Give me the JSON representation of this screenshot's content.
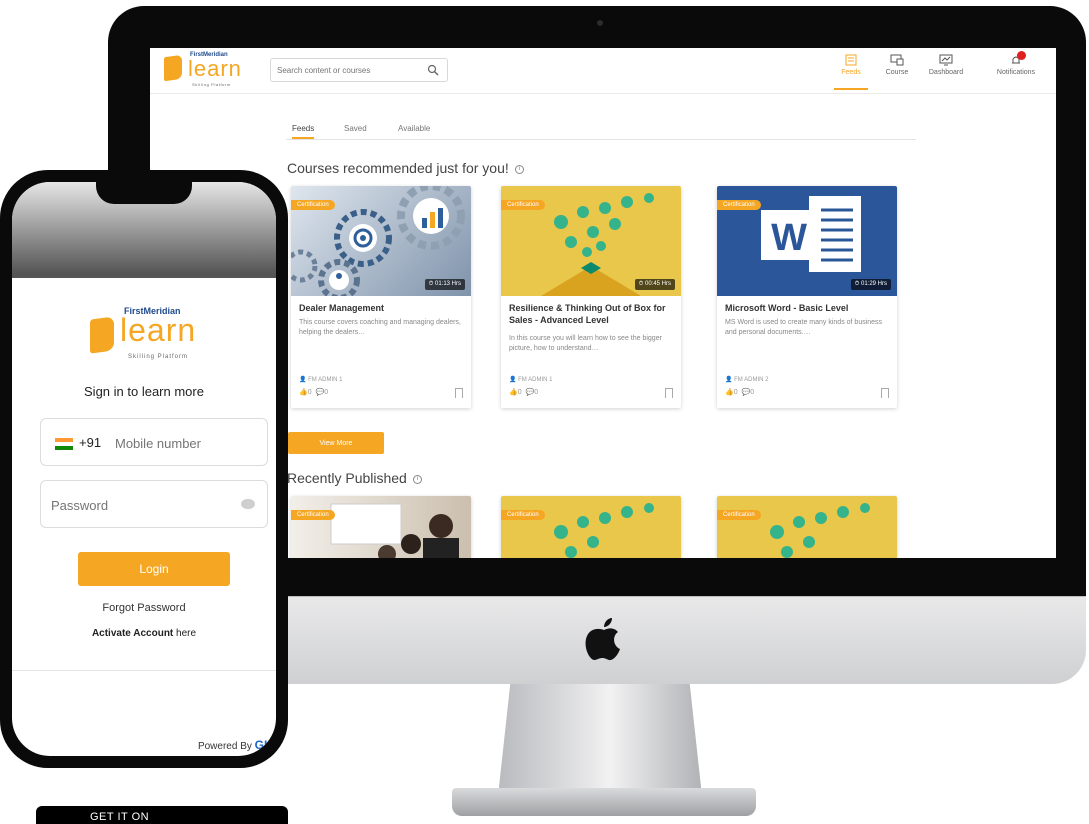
{
  "desktop": {
    "header": {
      "logo": {
        "brand_top": "FirstMeridian",
        "brand": "learn",
        "sub": "Skilling Platform"
      },
      "search_placeholder": "Search content or courses",
      "nav": [
        {
          "label": "Feeds",
          "icon": "feed-icon",
          "active": true
        },
        {
          "label": "Course",
          "icon": "course-icon",
          "active": false
        },
        {
          "label": "Dashboard",
          "icon": "dashboard-icon",
          "active": false
        },
        {
          "label": "Notifications",
          "icon": "bell-icon",
          "active": false
        }
      ]
    },
    "tabs": [
      {
        "label": "Feeds",
        "active": true
      },
      {
        "label": "Saved",
        "active": false
      },
      {
        "label": "Available",
        "active": false
      }
    ],
    "recommended": {
      "title": "Courses recommended just for you!",
      "cards": [
        {
          "badge": "Certification",
          "duration": "01:13 Hrs",
          "title": "Dealer Management",
          "desc": "This course covers coaching and managing dealers, helping the dealers…",
          "author": "FM ADMIN 1",
          "likes": "0",
          "dislikes": "0"
        },
        {
          "badge": "Certification",
          "duration": "00:45 Hrs",
          "title": "Resilience & Thinking Out of Box for Sales - Advanced Level",
          "desc": "In this course you will learn how to see the bigger picture, how to understand…",
          "author": "FM ADMIN 1",
          "likes": "0",
          "dislikes": "0"
        },
        {
          "badge": "Certification",
          "duration": "01:29 Hrs",
          "title": "Microsoft Word - Basic Level",
          "desc": "MS Word is used to create many kinds of business and personal documents.…",
          "author": "FM ADMIN 2",
          "likes": "0",
          "dislikes": "0"
        }
      ],
      "view_more": "View More"
    },
    "recent": {
      "title": "Recently Published",
      "cards": [
        {
          "badge": "Certification"
        },
        {
          "badge": "Certification"
        },
        {
          "badge": "Certification"
        }
      ]
    }
  },
  "mobile": {
    "logo": {
      "brand_top": "FirstMeridian",
      "brand": "learn",
      "sub": "Skilling Platform"
    },
    "title": "Sign in to learn more",
    "country_code": "+91",
    "mobile_placeholder": "Mobile number",
    "password_placeholder": "Password",
    "login": "Login",
    "forgot": "Forgot Password",
    "activate_bold": "Activate Account",
    "activate_rest": "here",
    "powered_by": "Powered By",
    "powered_logo": "GIC"
  },
  "store_badge": "GET IT ON",
  "colors": {
    "accent": "#f5a623",
    "brand_blue": "#1f4a8c",
    "word_blue": "#2b579a"
  }
}
